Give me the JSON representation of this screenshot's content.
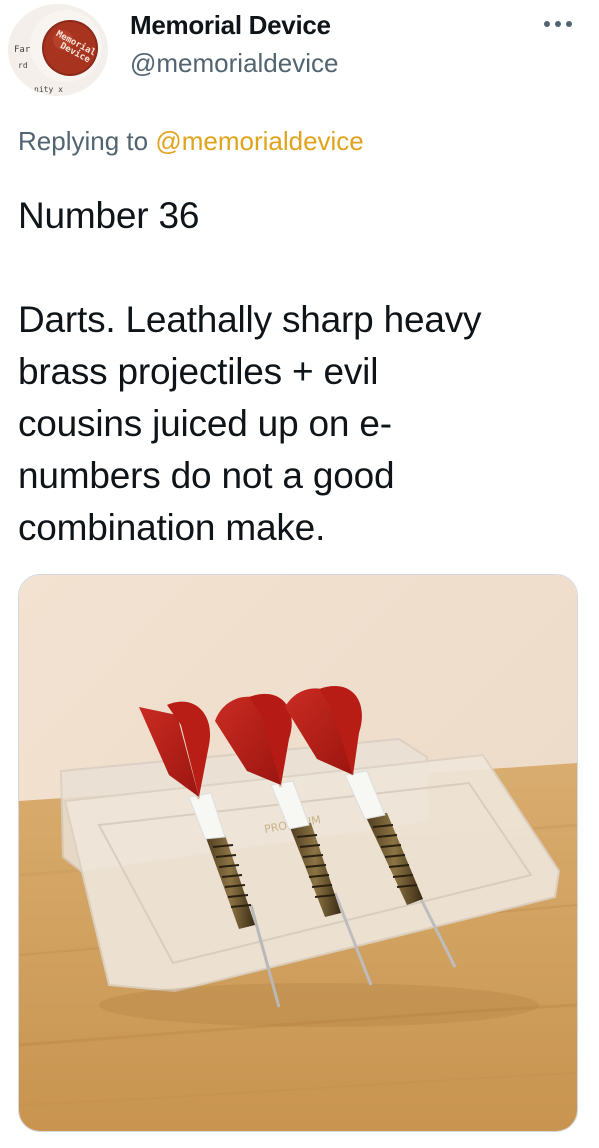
{
  "author": {
    "display_name": "Memorial Device",
    "handle": "@memorialdevice",
    "avatar_icon": "badge-avatar",
    "avatar_text": [
      "Far",
      "Memorial",
      "Device",
      "rd",
      "nity x"
    ]
  },
  "header": {
    "more_icon": "more-horizontal-icon"
  },
  "reply": {
    "prefix": "Replying to ",
    "mention": "@memorialdevice",
    "mention_color": "#e0a31c"
  },
  "tweet": {
    "text": "Number 36\n\nDarts. Leathally sharp heavy\nbrass projectiles + evil\ncousins juiced up on e-\nnumbers do not a good\ncombination make."
  },
  "media": {
    "photo_icon": "darts-photo"
  }
}
